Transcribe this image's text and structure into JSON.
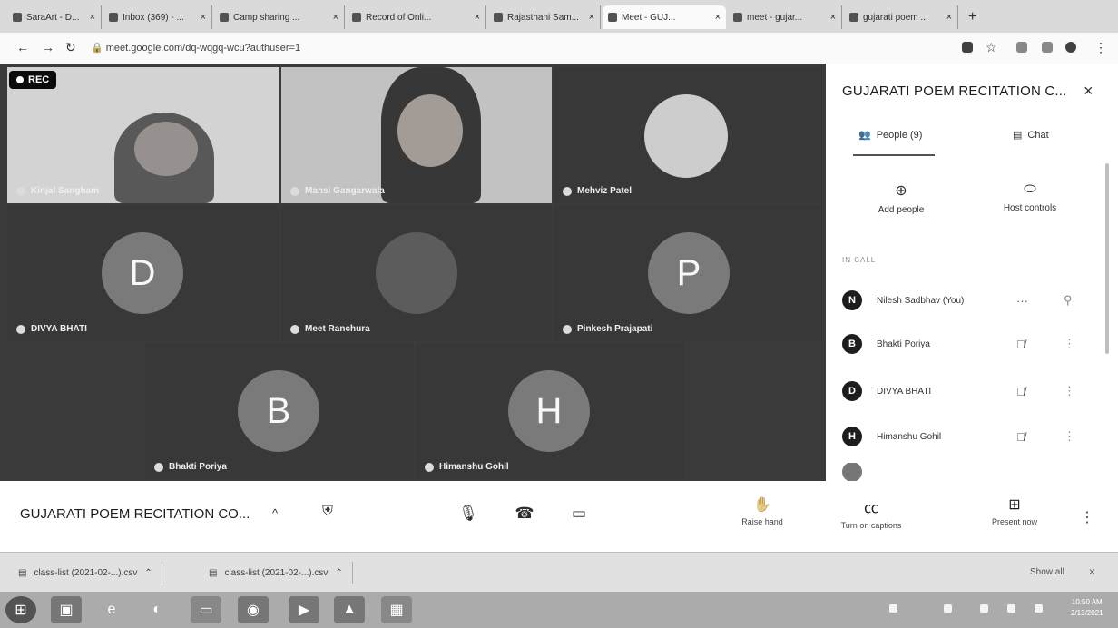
{
  "browser": {
    "tabs": [
      {
        "label": "SaraArt - D...",
        "active": false
      },
      {
        "label": "Inbox (369) - ...",
        "active": false
      },
      {
        "label": "Camp sharing ...",
        "active": false
      },
      {
        "label": "Record of Onli...",
        "active": false
      },
      {
        "label": "Rajasthani Sam...",
        "active": false
      },
      {
        "label": "Meet - GUJ...",
        "active": true
      },
      {
        "label": "meet - gujar...",
        "active": false
      },
      {
        "label": "gujarati poem ...",
        "active": false
      }
    ],
    "new_tab": "+",
    "url": "meet.google.com/dq-wqgq-wcu?authuser=1"
  },
  "meet": {
    "rec_label": "REC",
    "tiles": [
      {
        "name": "Kinjal Sangham",
        "initial": ""
      },
      {
        "name": "Mansi Gangarwala",
        "initial": ""
      },
      {
        "name": "Mehviz Patel",
        "initial": ""
      },
      {
        "name": "DIVYA BHATI",
        "initial": "D"
      },
      {
        "name": "Meet Ranchura",
        "initial": ""
      },
      {
        "name": "Pinkesh Prajapati",
        "initial": "P"
      },
      {
        "name": "Bhakti Poriya",
        "initial": "B"
      },
      {
        "name": "Himanshu Gohil",
        "initial": "H"
      }
    ]
  },
  "panel": {
    "title": "GUJARATI POEM RECITATION C...",
    "close": "×",
    "tab_people": "People (9)",
    "tab_chat": "Chat",
    "add_people": "Add people",
    "host_controls": "Host controls",
    "in_call": "IN CALL",
    "participants": [
      {
        "initial": "N",
        "name": "Nilesh Sadbhav (You)"
      },
      {
        "initial": "B",
        "name": "Bhakti Poriya"
      },
      {
        "initial": "D",
        "name": "DIVYA BHATI"
      },
      {
        "initial": "H",
        "name": "Himanshu Gohil"
      }
    ]
  },
  "controls": {
    "meeting_title": "GUJARATI POEM RECITATION CO...",
    "caret": "^",
    "raise_hand": "Raise hand",
    "captions": "Turn on captions",
    "present": "Present now"
  },
  "downloads": {
    "items": [
      "class-list (2021-02-...).csv",
      "class-list (2021-02-...).csv"
    ],
    "show_all": "Show all",
    "close": "×"
  },
  "taskbar": {
    "time": "10:50 AM",
    "date": "2/13/2021"
  }
}
